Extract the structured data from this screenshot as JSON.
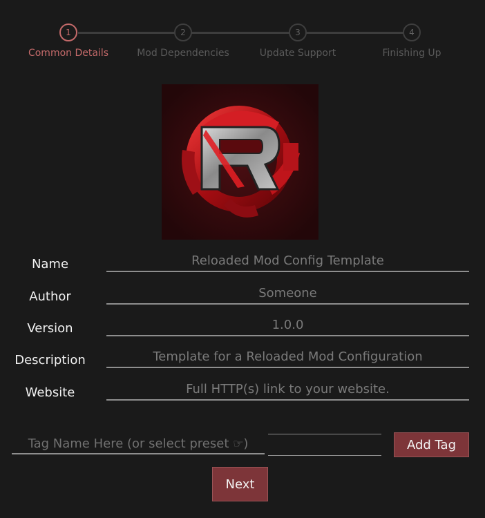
{
  "stepper": {
    "steps": [
      {
        "number": "1",
        "label": "Common Details",
        "active": true
      },
      {
        "number": "2",
        "label": "Mod Dependencies",
        "active": false
      },
      {
        "number": "3",
        "label": "Update Support",
        "active": false
      },
      {
        "number": "4",
        "label": "Finishing Up",
        "active": false
      }
    ]
  },
  "logo": {
    "icon": "reloaded-logo-icon"
  },
  "form": {
    "name": {
      "label": "Name",
      "placeholder": "Reloaded Mod Config Template"
    },
    "author": {
      "label": "Author",
      "placeholder": "Someone"
    },
    "version": {
      "label": "Version",
      "placeholder": "1.0.0"
    },
    "description": {
      "label": "Description",
      "placeholder": "Template for a Reloaded Mod Configuration"
    },
    "website": {
      "label": "Website",
      "placeholder": "Full HTTP(s) link to your website."
    }
  },
  "tags": {
    "input_placeholder": "Tag Name Here (or select preset",
    "input_suffix": ")",
    "preset_icon": "pointing-hand-icon",
    "add_label": "Add Tag"
  },
  "footer": {
    "next_label": "Next"
  },
  "colors": {
    "background": "#1a1a1a",
    "accent": "#c46a6a",
    "button": "#7d3539"
  }
}
